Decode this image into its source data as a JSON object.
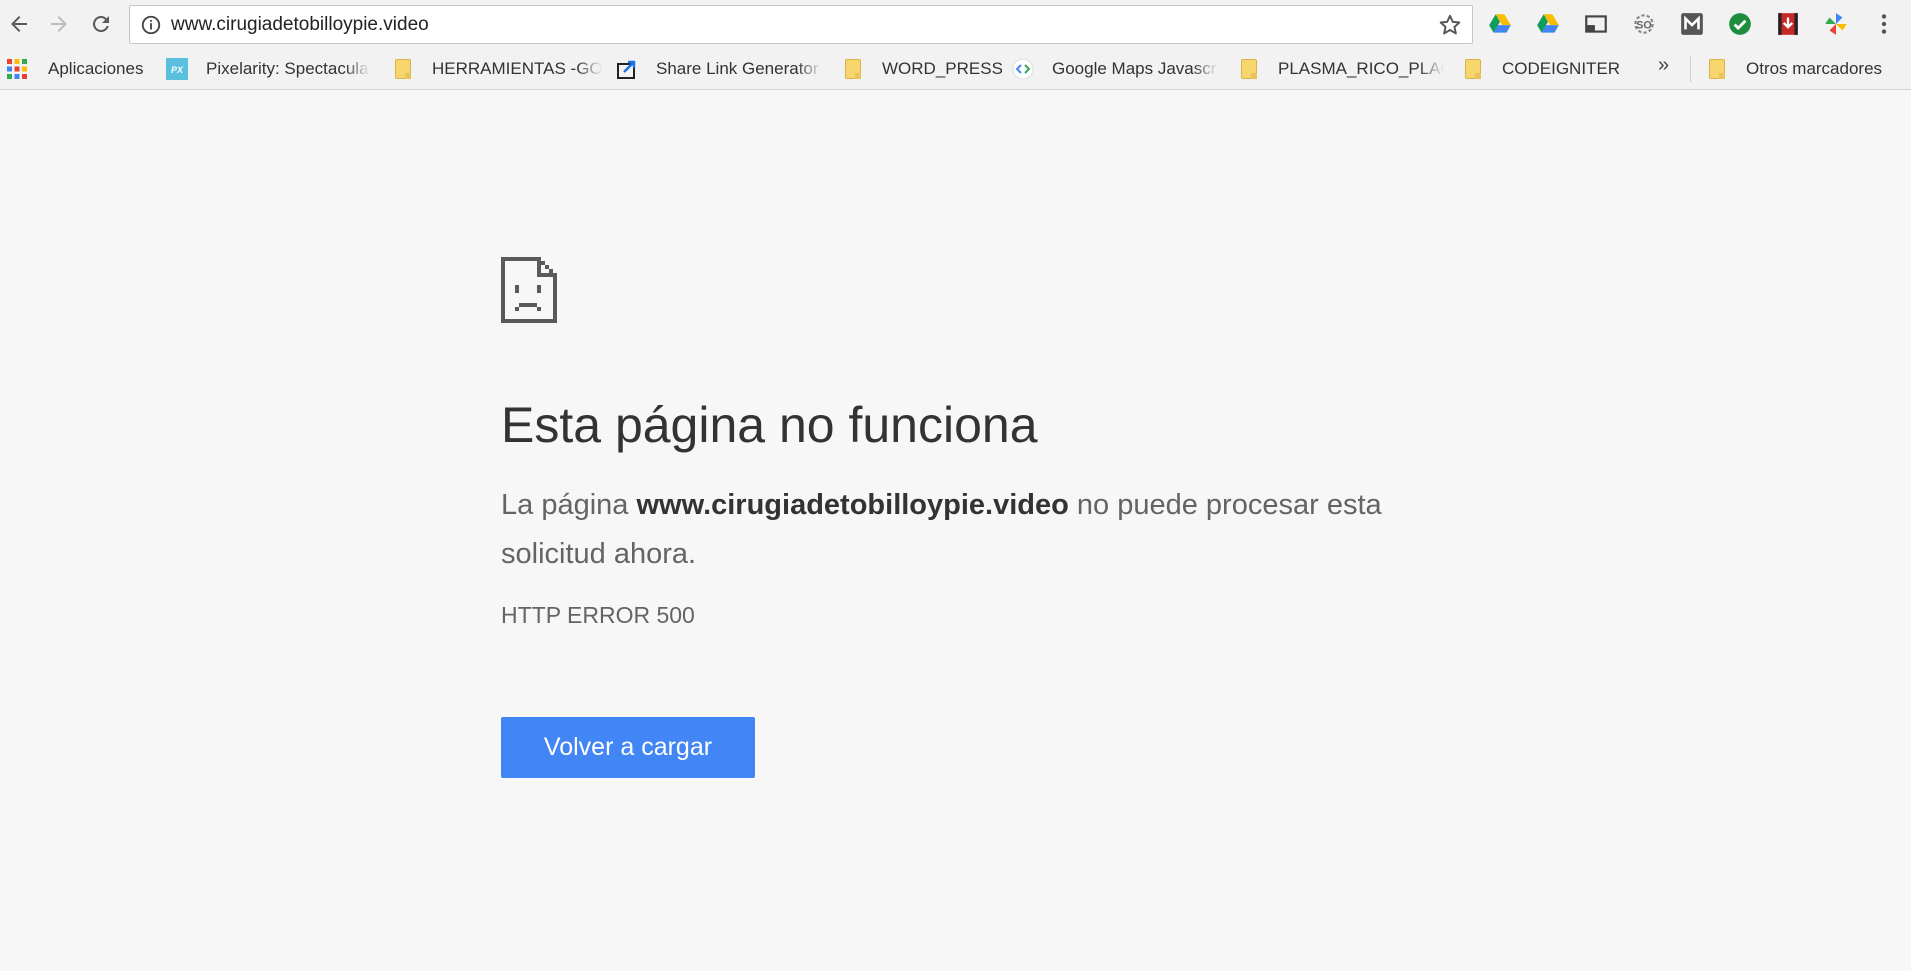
{
  "browser": {
    "url": "www.cirugiadetobilloypie.video",
    "icons": {
      "back": "arrow-left-icon",
      "forward": "arrow-right-icon",
      "reload": "refresh-icon",
      "info": "info-icon",
      "star": "star-icon",
      "menu": "kebab-menu-icon"
    },
    "extensions": [
      "google-drive-icon",
      "google-drive-icon",
      "cast-icon",
      "seo-icon",
      "m-extension-icon",
      "checkmark-extension-icon",
      "video-download-icon",
      "pinwheel-icon"
    ]
  },
  "bookmarks": {
    "items": [
      {
        "label": "Aplicaciones",
        "icon": "apps-grid-icon"
      },
      {
        "label": "Pixelarity: Spectacular",
        "icon": "px-icon"
      },
      {
        "label": "HERRAMIENTAS -GOOGLE",
        "icon": "folder-icon"
      },
      {
        "label": "Share Link Generator",
        "icon": "share-icon"
      },
      {
        "label": "WORD_PRESS",
        "icon": "folder-icon"
      },
      {
        "label": "Google Maps Javascript",
        "icon": "code-icon"
      },
      {
        "label": "PLASMA_RICO_PLACA",
        "icon": "folder-icon"
      },
      {
        "label": "CODEIGNITER",
        "icon": "folder-icon"
      }
    ],
    "overflow": "»",
    "other": {
      "label": "Otros marcadores",
      "icon": "folder-icon"
    }
  },
  "error": {
    "icon": "sad-page-icon",
    "title": "Esta página no funciona",
    "desc_prefix": "La página ",
    "desc_domain": "www.cirugiadetobilloypie.video",
    "desc_suffix": " no puede procesar esta solicitud ahora.",
    "code": "HTTP ERROR 500",
    "reload_label": "Volver a cargar",
    "button_color": "#4285f4"
  }
}
